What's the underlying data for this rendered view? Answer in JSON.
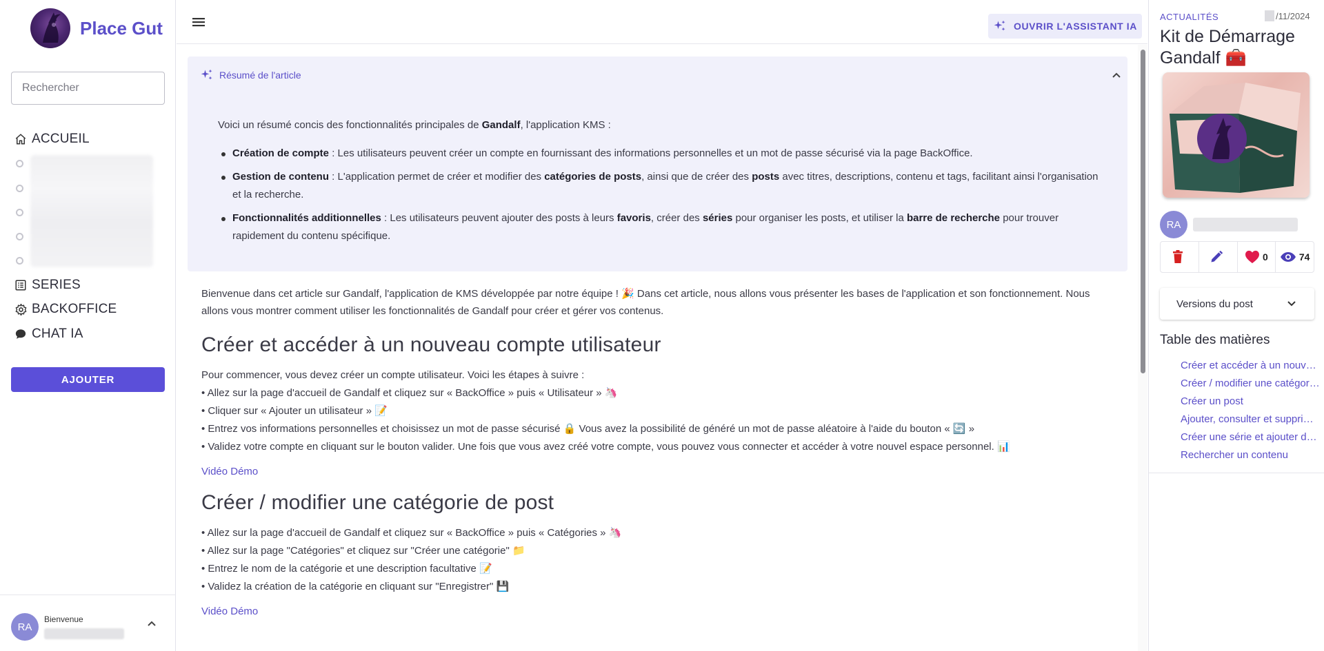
{
  "app": {
    "name": "Place Gut"
  },
  "search": {
    "placeholder": "Rechercher"
  },
  "nav": {
    "home": "ACCUEIL",
    "series": "SERIES",
    "backoffice": "BACKOFFICE",
    "chat": "CHAT IA"
  },
  "add_button": "AJOUTER",
  "user": {
    "initials": "RA",
    "welcome": "Bienvenue"
  },
  "topbar": {
    "ai_button": "OUVRIR L'ASSISTANT IA"
  },
  "summary": {
    "heading": "Résumé de l'article",
    "intro_pre": "Voici un résumé concis des fonctionnalités principales de ",
    "intro_bold": "Gandalf",
    "intro_post": ", l'application KMS :",
    "item1": {
      "b1": "Création de compte",
      "t1": " : Les utilisateurs peuvent créer un compte en fournissant des informations personnelles et un mot de passe sécurisé via la page BackOffice."
    },
    "item2": {
      "b1": "Gestion de contenu",
      "t1": " : L'application permet de créer et modifier des ",
      "b2": "catégories de posts",
      "t2": ", ainsi que de créer des ",
      "b3": "posts",
      "t3": " avec titres, descriptions, contenu et tags, facilitant ainsi l'organisation et la recherche."
    },
    "item3": {
      "b1": "Fonctionnalités additionnelles",
      "t1": " : Les utilisateurs peuvent ajouter des posts à leurs ",
      "b2": "favoris",
      "t2": ", créer des ",
      "b3": "séries",
      "t3": " pour organiser les posts, et utiliser la ",
      "b4": "barre de recherche",
      "t4": " pour trouver rapidement du contenu spécifique."
    }
  },
  "article": {
    "intro": "Bienvenue dans cet article sur Gandalf, l'application de KMS développée par notre équipe ! 🎉 Dans cet article, nous allons vous présenter les bases de l'application et son fonctionnement. Nous allons vous montrer comment utiliser les fonctionnalités de Gandalf pour créer et gérer vos contenus.",
    "section1": {
      "title": "Créer et accéder à un nouveau compte utilisateur",
      "lead": "Pour commencer, vous devez créer un compte utilisateur. Voici les étapes à suivre :",
      "steps": [
        "• Allez sur la page d'accueil de Gandalf et cliquez sur « BackOffice » puis « Utilisateur » 🦄",
        "• Cliquer sur « Ajouter un utilisateur » 📝",
        "• Entrez vos informations personnelles et choisissez un mot de passe sécurisé 🔒 Vous avez la possibilité de généré un mot de passe aléatoire à l'aide du bouton « 🔄 »",
        "• Validez votre compte en cliquant sur le bouton valider. Une fois que vous avez créé votre compte, vous pouvez vous connecter et accéder à votre nouvel espace personnel. 📊"
      ],
      "demo": "Vidéo Démo"
    },
    "section2": {
      "title": "Créer / modifier une catégorie de post",
      "steps": [
        "• Allez sur la page d'accueil de Gandalf et cliquez sur « BackOffice » puis « Catégories » 🦄",
        "• Allez sur la page \"Catégories\" et cliquez sur \"Créer une catégorie\" 📁",
        "• Entrez le nom de la catégorie et une description facultative 📝",
        "• Validez la création de la catégorie en cliquant sur \"Enregistrer\" 💾"
      ],
      "demo": "Vidéo Démo"
    }
  },
  "post": {
    "category": "ACTUALITÉS",
    "date": "/11/2024",
    "title": "Kit de Démarrage Gandalf 🧰",
    "author_initials": "RA",
    "likes": "0",
    "views": "74",
    "versions_label": "Versions du post"
  },
  "toc": {
    "title": "Table des matières",
    "items": [
      "Créer et accéder à un nouveau compte utilisateur",
      "Créer / modifier une catégorie de post",
      "Créer un post",
      "Ajouter, consulter et supprimer des favoris",
      "Créer une série et ajouter des posts",
      "Rechercher un contenu"
    ]
  },
  "colors": {
    "accent": "#5b4fc9",
    "button": "#5b4fd9",
    "summary_bg": "#f1f1fb",
    "delete": "#d62020",
    "like": "#e01b4c"
  }
}
